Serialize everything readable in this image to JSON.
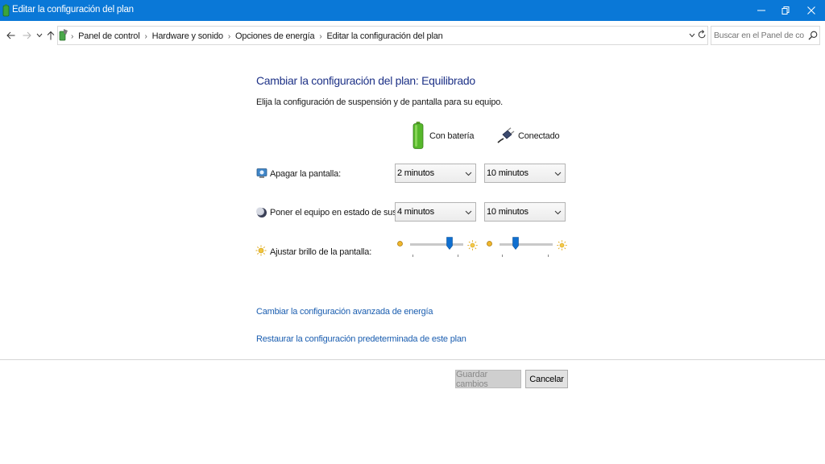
{
  "window": {
    "title": "Editar la configuración del plan",
    "colors": {
      "titlebar": "#0a78d7",
      "heading": "#1e3287",
      "link": "#1b5eb0"
    }
  },
  "address": {
    "breadcrumbs": [
      "Panel de control",
      "Hardware y sonido",
      "Opciones de energía",
      "Editar la configuración del plan"
    ],
    "search_placeholder": "Buscar en el Panel de control"
  },
  "main": {
    "heading": "Cambiar la configuración del plan: Equilibrado",
    "subtitle": "Elija la configuración de suspensión y de pantalla para su equipo.",
    "columns": {
      "battery": "Con batería",
      "plugged": "Conectado"
    },
    "rows": {
      "display_off": {
        "label": "Apagar la pantalla:",
        "battery_value": "2 minutos",
        "plugged_value": "10 minutos"
      },
      "sleep": {
        "label": "Poner el equipo en estado de suspensión:",
        "battery_value": "4 minutos",
        "plugged_value": "10 minutos"
      },
      "brightness": {
        "label": "Ajustar brillo de la pantalla:",
        "battery_level": 0.82,
        "plugged_level": 0.3
      }
    },
    "links": {
      "advanced": "Cambiar la configuración avanzada de energía",
      "restore": "Restaurar la configuración predeterminada de este plan"
    }
  },
  "footer": {
    "save_label": "Guardar cambios",
    "cancel_label": "Cancelar"
  }
}
